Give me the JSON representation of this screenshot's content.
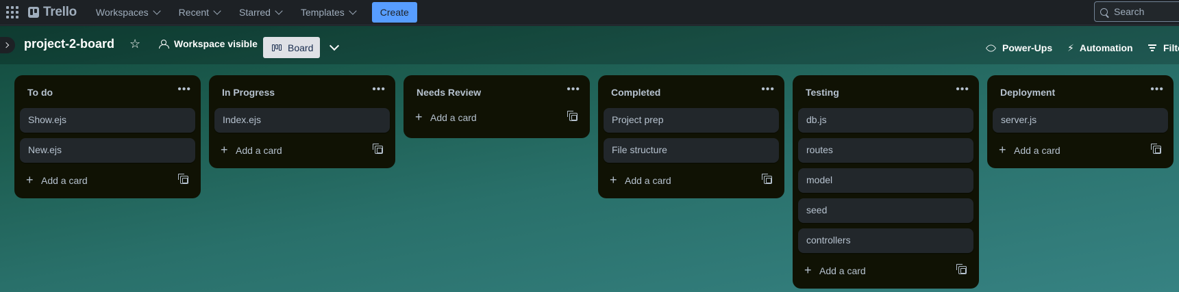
{
  "topbar": {
    "logo": "Trello",
    "menus": [
      {
        "label": "Workspaces"
      },
      {
        "label": "Recent"
      },
      {
        "label": "Starred"
      },
      {
        "label": "Templates"
      }
    ],
    "create_label": "Create",
    "search_placeholder": "Search"
  },
  "board": {
    "title": "project-2-board",
    "visibility": "Workspace visible",
    "view_label": "Board",
    "actions": {
      "powerups": "Power-Ups",
      "automation": "Automation",
      "filter": "Filte"
    }
  },
  "add_card_label": "Add a card",
  "lists": [
    {
      "title": "To do",
      "cards": [
        "Show.ejs",
        "New.ejs"
      ]
    },
    {
      "title": "In Progress",
      "cards": [
        "Index.ejs"
      ]
    },
    {
      "title": "Needs Review",
      "cards": []
    },
    {
      "title": "Completed",
      "cards": [
        "Project prep",
        "File structure"
      ]
    },
    {
      "title": "Testing",
      "cards": [
        "db.js",
        "routes",
        "model",
        "seed",
        "controllers"
      ]
    },
    {
      "title": "Deployment",
      "cards": [
        "server.js"
      ]
    }
  ],
  "colors": {
    "create_button": "#579dff",
    "list_bg": "#101204",
    "card_bg": "#22272b"
  }
}
